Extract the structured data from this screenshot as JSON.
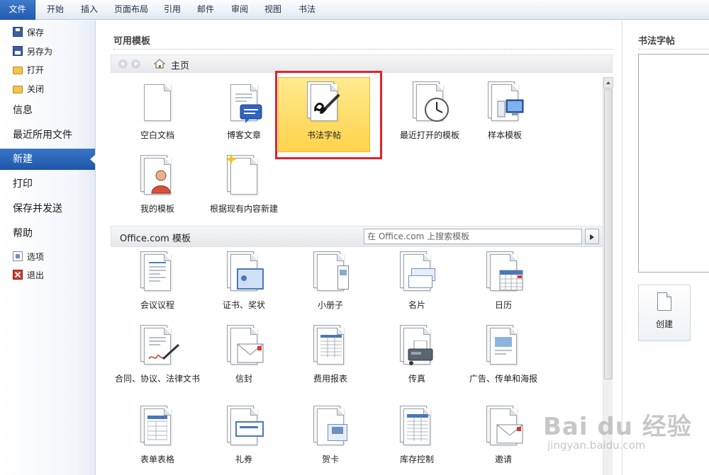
{
  "ribbon": {
    "tabs": [
      {
        "label": "文件"
      },
      {
        "label": "开始"
      },
      {
        "label": "插入"
      },
      {
        "label": "页面布局"
      },
      {
        "label": "引用"
      },
      {
        "label": "邮件"
      },
      {
        "label": "审阅"
      },
      {
        "label": "视图"
      },
      {
        "label": "书法"
      }
    ]
  },
  "backstage": {
    "small_top": [
      {
        "label": "保存",
        "icon": "save-icon"
      },
      {
        "label": "另存为",
        "icon": "save-as-icon"
      },
      {
        "label": "打开",
        "icon": "open-folder-icon"
      },
      {
        "label": "关闭",
        "icon": "close-folder-icon"
      }
    ],
    "big": [
      {
        "label": "信息"
      },
      {
        "label": "最近所用文件"
      },
      {
        "label": "新建",
        "active": true
      },
      {
        "label": "打印"
      },
      {
        "label": "保存并发送"
      },
      {
        "label": "帮助"
      }
    ],
    "small_bottom": [
      {
        "label": "选项",
        "icon": "options-icon"
      },
      {
        "label": "退出",
        "icon": "exit-icon"
      }
    ]
  },
  "main": {
    "section_title": "可用模板",
    "breadcrumb": "主页",
    "available": [
      {
        "label": "空白文档",
        "icon": "blank-document-icon"
      },
      {
        "label": "博客文章",
        "icon": "blog-post-icon"
      },
      {
        "label": "书法字帖",
        "icon": "calligraphy-icon",
        "selected": true
      },
      {
        "label": "最近打开的模板",
        "icon": "recent-templates-icon"
      },
      {
        "label": "样本模板",
        "icon": "sample-templates-icon"
      },
      {
        "label": "我的模板",
        "icon": "my-templates-icon"
      },
      {
        "label": "根据现有内容新建",
        "icon": "new-from-existing-icon"
      }
    ],
    "office_title": "Office.com 模板",
    "search_placeholder": "在 Office.com 上搜索模板",
    "office": [
      {
        "label": "会议议程",
        "icon": "agenda-icon"
      },
      {
        "label": "证书、奖状",
        "icon": "certificate-icon"
      },
      {
        "label": "小册子",
        "icon": "brochure-icon"
      },
      {
        "label": "名片",
        "icon": "business-card-icon"
      },
      {
        "label": "日历",
        "icon": "calendar-icon"
      },
      {
        "label": "合同、协议、法律文书",
        "icon": "contract-icon"
      },
      {
        "label": "信封",
        "icon": "envelope-icon"
      },
      {
        "label": "费用报表",
        "icon": "expense-report-icon"
      },
      {
        "label": "传真",
        "icon": "fax-icon"
      },
      {
        "label": "广告、传单和海报",
        "icon": "flyer-icon"
      },
      {
        "label": "表单表格",
        "icon": "form-icon"
      },
      {
        "label": "礼券",
        "icon": "gift-certificate-icon"
      },
      {
        "label": "贺卡",
        "icon": "greeting-card-icon"
      },
      {
        "label": "库存控制",
        "icon": "inventory-icon"
      },
      {
        "label": "邀请",
        "icon": "invitation-icon"
      }
    ]
  },
  "preview": {
    "title": "书法字帖",
    "create_label": "创建"
  },
  "watermark": {
    "main": "Bai du 经验",
    "sub": "jingyan.baidu.com"
  },
  "colors": {
    "accent": "#2259b0",
    "selected": "#ffd24c",
    "highlight_frame": "#e0242c"
  }
}
